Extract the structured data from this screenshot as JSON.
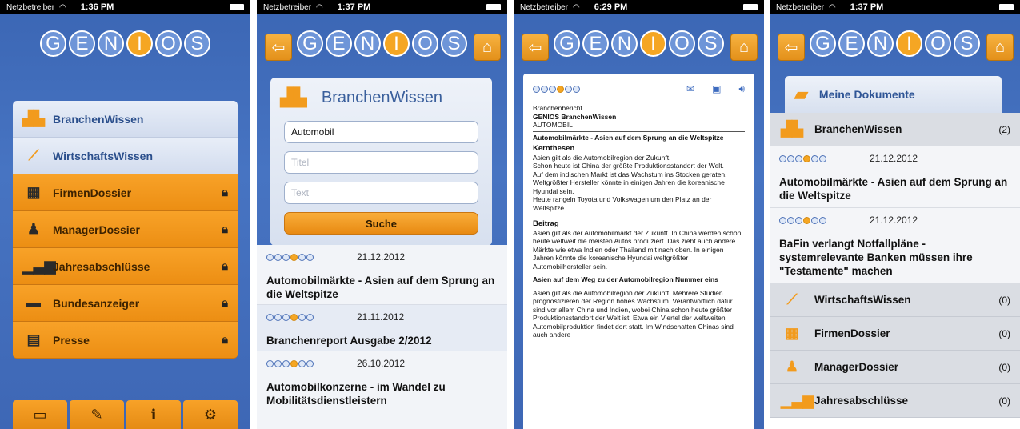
{
  "status": {
    "carrier": "Netzbetreiber",
    "time_1": "1:36 PM",
    "time_2": "1:37 PM",
    "time_3": "6:29 PM",
    "time_4": "1:37 PM"
  },
  "logo": {
    "letters": [
      "G",
      "E",
      "N",
      "I",
      "O",
      "S"
    ]
  },
  "colors": {
    "brand_blue": "#3b66b4",
    "accent_orange": "#f29b1d"
  },
  "main_menu": {
    "items": [
      {
        "label": "BranchenWissen",
        "icon": "factory-icon",
        "locked": false
      },
      {
        "label": "WirtschaftsWissen",
        "icon": "line-chart-icon",
        "locked": false
      },
      {
        "label": "FirmenDossier",
        "icon": "building-icon",
        "locked": true
      },
      {
        "label": "ManagerDossier",
        "icon": "person-icon",
        "locked": true
      },
      {
        "label": "Jahresabschlüsse",
        "icon": "bar-chart-icon",
        "locked": true
      },
      {
        "label": "Bundesanzeiger",
        "icon": "flag-icon",
        "locked": true
      },
      {
        "label": "Presse",
        "icon": "newspaper-icon",
        "locked": true
      }
    ],
    "tabs": [
      "folder-icon",
      "edit-icon",
      "info-icon",
      "settings-icon"
    ]
  },
  "search": {
    "title": "BranchenWissen",
    "query_value": "Automobil",
    "title_placeholder": "Titel",
    "text_placeholder": "Text",
    "button_label": "Suche",
    "results": [
      {
        "date": "21.12.2012",
        "title": "Automobilmärkte - Asien auf dem Sprung an die Weltspitze"
      },
      {
        "date": "21.11.2012",
        "title": "Branchenreport Ausgabe 2/2012"
      },
      {
        "date": "26.10.2012",
        "title": "Automobilkonzerne - im Wandel zu Mobilitätsdienstleistern"
      }
    ]
  },
  "document": {
    "kind": "Branchenbericht",
    "source": "GENIOS BranchenWissen",
    "branch": "AUTOMOBIL",
    "headline": "Automobilmärkte - Asien auf dem Sprung an die Weltspitze",
    "section1": "Kernthesen",
    "para1": [
      "Asien gilt als die Automobilregion der Zukunft.",
      "Schon heute ist China der größte Produktionsstandort der Welt.",
      "Auf dem indischen Markt ist das Wachstum ins Stocken geraten.",
      "Weltgrößter Hersteller könnte in einigen Jahren die koreanische Hyundai sein.",
      "Heute rangeln Toyota und Volkswagen um den Platz an der Weltspitze."
    ],
    "section2": "Beitrag",
    "para2": "Asien gilt als der Automobilmarkt der Zukunft. In China werden schon heute weltweit die meisten Autos produziert. Das zieht auch andere Märkte wie etwa Indien oder Thailand mit nach oben. In einigen Jahren könnte die koreanische Hyundai weltgrößter Automobilhersteller sein.",
    "section3": "Asien auf dem Weg zu der Automobilregion Nummer eins",
    "para3": "Asien gilt als die Automobilregion der Zukunft. Mehrere Studien prognostizieren der Region hohes Wachstum. Verantwortlich dafür sind vor allem China und Indien, wobei China schon heute größter Produktionsstandort der Welt ist. Etwa ein Viertel der weltweiten Automobilproduktion findet dort statt. Im Windschatten Chinas sind auch andere"
  },
  "my_documents": {
    "title": "Meine Dokumente",
    "categories": [
      {
        "label": "BranchenWissen",
        "count": "(2)",
        "icon": "factory-icon"
      },
      {
        "label": "WirtschaftsWissen",
        "count": "(0)",
        "icon": "line-chart-icon"
      },
      {
        "label": "FirmenDossier",
        "count": "(0)",
        "icon": "building-icon"
      },
      {
        "label": "ManagerDossier",
        "count": "(0)",
        "icon": "person-icon"
      },
      {
        "label": "Jahresabschlüsse",
        "count": "(0)",
        "icon": "bar-chart-icon"
      }
    ],
    "entries": [
      {
        "date": "21.12.2012",
        "title": "Automobilmärkte - Asien auf dem Sprung an die Weltspitze"
      },
      {
        "date": "21.12.2012",
        "title": "BaFin verlangt Notfallpläne - systemrelevante Banken müssen ihre \"Testamente\" machen"
      }
    ]
  }
}
